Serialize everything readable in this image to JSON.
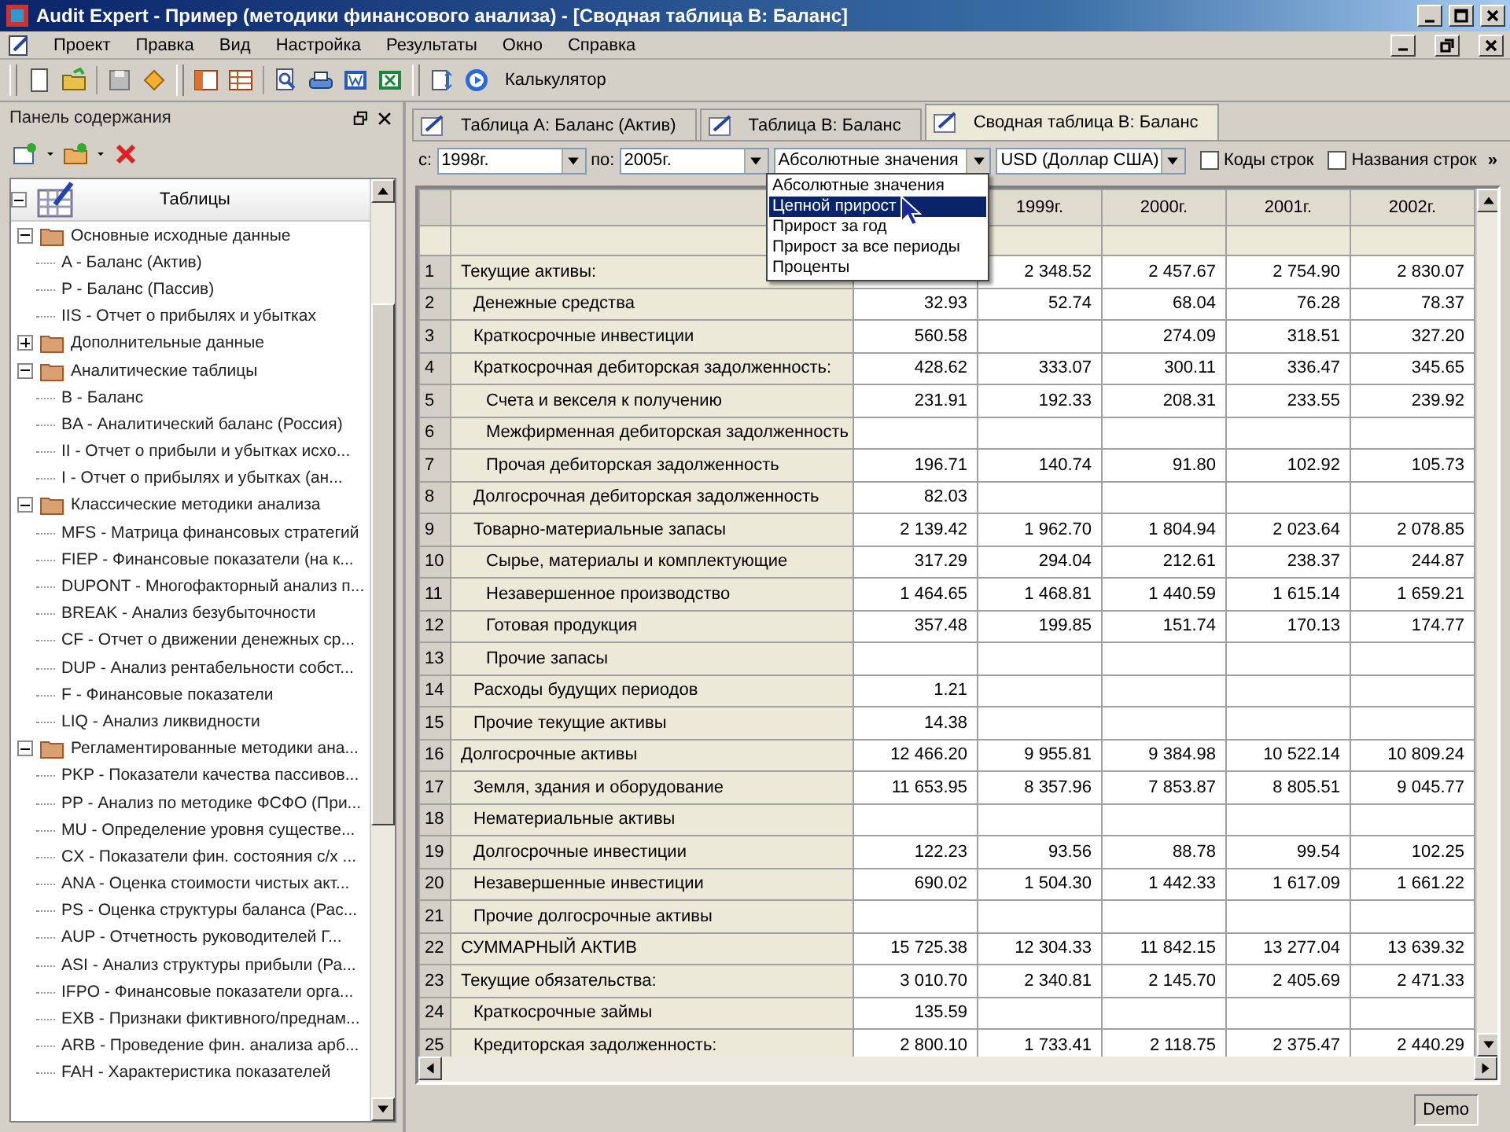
{
  "window": {
    "title": "Audit Expert - Пример (методики финансового анализа)  - [Сводная таблица В: Баланс]"
  },
  "menu": [
    "Проект",
    "Правка",
    "Вид",
    "Настройка",
    "Результаты",
    "Окно",
    "Справка"
  ],
  "toolbar": {
    "calculator": "Калькулятор"
  },
  "contents_panel": {
    "title": "Панель содержания",
    "tree": {
      "label": "Таблицы",
      "expanded": true,
      "children": [
        {
          "label": "Основные исходные данные",
          "expanded": true,
          "children": [
            {
              "label": "A - Баланс (Актив)"
            },
            {
              "label": "P - Баланс (Пассив)"
            },
            {
              "label": "IIS - Отчет о прибылях и убытках"
            }
          ]
        },
        {
          "label": "Дополнительные данные",
          "expanded": false
        },
        {
          "label": "Аналитические таблицы",
          "expanded": true,
          "children": [
            {
              "label": "B - Баланс"
            },
            {
              "label": "BA - Аналитический баланс (Россия)"
            },
            {
              "label": "II - Отчет о прибыли и убытках исхо..."
            },
            {
              "label": "I - Отчет о прибылях и убытках (ан..."
            }
          ]
        },
        {
          "label": "Классические методики анализа",
          "expanded": true,
          "children": [
            {
              "label": "MFS - Матрица финансовых стратегий"
            },
            {
              "label": "FIEP - Финансовые показатели (на к..."
            },
            {
              "label": "DUPONT - Многофакторный анализ п..."
            },
            {
              "label": "BREAK - Анализ безубыточности"
            },
            {
              "label": "CF - Отчет о движении денежных ср..."
            },
            {
              "label": "DUP - Анализ рентабельности собст..."
            },
            {
              "label": "F - Финансовые показатели"
            },
            {
              "label": "LIQ - Анализ ликвидности"
            }
          ]
        },
        {
          "label": "Регламентированные методики ана...",
          "expanded": true,
          "children": [
            {
              "label": "PKP - Показатели качества пассивов..."
            },
            {
              "label": "PP - Анализ по методике ФСФО (При..."
            },
            {
              "label": "MU - Определение уровня существе..."
            },
            {
              "label": "CX - Показатели фин. состояния с/х ..."
            },
            {
              "label": "ANA - Оценка стоимости чистых акт..."
            },
            {
              "label": "PS - Оценка структуры баланса (Рас..."
            },
            {
              "label": "AUP - Отчетность руководителей Г..."
            },
            {
              "label": "ASI - Анализ структуры прибыли (Ра..."
            },
            {
              "label": "IFPO - Финансовые показатели орга..."
            },
            {
              "label": "EXB - Признаки фиктивного/преднам..."
            },
            {
              "label": "ARB - Проведение фин. анализа арб..."
            },
            {
              "label": "FAH - Характеристика показателей"
            }
          ]
        }
      ]
    }
  },
  "tabs": [
    {
      "label": "Таблица А: Баланс (Актив)",
      "selected": false
    },
    {
      "label": "Таблица В: Баланс",
      "selected": false
    },
    {
      "label": "Сводная таблица В: Баланс",
      "selected": true
    }
  ],
  "filters": {
    "from_label": "с:",
    "from": "1998г.",
    "to_label": "по:",
    "to": "2005г.",
    "mode": "Абсолютные значения",
    "currency": "USD (Доллар США)",
    "checkboxes": [
      {
        "label": "Коды строк",
        "checked": false
      },
      {
        "label": "Названия строк",
        "checked": false
      }
    ],
    "more": "»"
  },
  "mode_dropdown": [
    {
      "label": "Абсолютные значения",
      "selected": false
    },
    {
      "label": "Цепной прирост",
      "selected": true
    },
    {
      "label": "Прирост за год",
      "selected": false
    },
    {
      "label": "Прирост за все периоды",
      "selected": false
    },
    {
      "label": "Проценты",
      "selected": false
    }
  ],
  "table": {
    "columns": [
      "",
      "1999г.",
      "2000г.",
      "2001г.",
      "2002г."
    ],
    "rows": [
      {
        "num": "1",
        "label": "Текущие активы:",
        "cells": [
          {
            "blank": true
          },
          {
            "value": "2 348.52"
          },
          {
            "value": "2 457.67"
          },
          {
            "value": "2 754.90"
          },
          {
            "value": "2 830.07"
          }
        ],
        "children": [
          {
            "num": "2",
            "label": "Денежные средства",
            "cells": [
              {
                "value": "32.93"
              },
              {
                "value": "52.74"
              },
              {
                "value": "68.04"
              },
              {
                "value": "76.28"
              },
              {
                "value": "78.37"
              }
            ]
          },
          {
            "num": "3",
            "label": "Краткосрочные инвестиции",
            "cells": [
              {
                "value": "560.58"
              },
              {
                "blank": true
              },
              {
                "value": "274.09"
              },
              {
                "value": "318.51"
              },
              {
                "value": "327.20"
              }
            ]
          },
          {
            "num": "4",
            "label": "Краткосрочная дебиторская задолженность:",
            "cells": [
              {
                "value": "428.62"
              },
              {
                "value": "333.07"
              },
              {
                "value": "300.11"
              },
              {
                "value": "336.47"
              },
              {
                "value": "345.65"
              }
            ],
            "children": [
              {
                "num": "5",
                "label": "Счета и векселя к получению",
                "cells": [
                  {
                    "value": "231.91"
                  },
                  {
                    "value": "192.33"
                  },
                  {
                    "value": "208.31"
                  },
                  {
                    "value": "233.55"
                  },
                  {
                    "value": "239.92"
                  }
                ]
              },
              {
                "num": "6",
                "label": "Межфирменная дебиторская задолженность"
              },
              {
                "num": "7",
                "label": "Прочая дебиторская задолженность",
                "cells": [
                  {
                    "value": "196.71"
                  },
                  {
                    "value": "140.74"
                  },
                  {
                    "value": "91.80"
                  },
                  {
                    "value": "102.92"
                  },
                  {
                    "value": "105.73"
                  }
                ]
              }
            ]
          },
          {
            "num": "8",
            "label": "Долгосрочная дебиторская задолженность",
            "cells": [
              {
                "value": "82.03"
              }
            ]
          },
          {
            "num": "9",
            "label": "Товарно-материальные запасы",
            "cells": [
              {
                "value": "2 139.42"
              },
              {
                "value": "1 962.70"
              },
              {
                "value": "1 804.94"
              },
              {
                "value": "2 023.64"
              },
              {
                "value": "2 078.85"
              }
            ],
            "children": [
              {
                "num": "10",
                "label": "Сырье, материалы и комплектующие",
                "cells": [
                  {
                    "value": "317.29"
                  },
                  {
                    "value": "294.04"
                  },
                  {
                    "value": "212.61"
                  },
                  {
                    "value": "238.37"
                  },
                  {
                    "value": "244.87"
                  }
                ]
              },
              {
                "num": "11",
                "label": "Незавершенное производство",
                "cells": [
                  {
                    "value": "1 464.65"
                  },
                  {
                    "value": "1 468.81"
                  },
                  {
                    "value": "1 440.59"
                  },
                  {
                    "value": "1 615.14"
                  },
                  {
                    "value": "1 659.21"
                  }
                ]
              },
              {
                "num": "12",
                "label": "Готовая продукция",
                "cells": [
                  {
                    "value": "357.48"
                  },
                  {
                    "value": "199.85"
                  },
                  {
                    "value": "151.74"
                  },
                  {
                    "value": "170.13"
                  },
                  {
                    "value": "174.77"
                  }
                ]
              },
              {
                "num": "13",
                "label": "Прочие запасы"
              }
            ]
          },
          {
            "num": "14",
            "label": "Расходы будущих периодов",
            "cells": [
              {
                "value": "1.21"
              }
            ]
          },
          {
            "num": "15",
            "label": "Прочие текущие активы",
            "cells": [
              {
                "value": "14.38"
              }
            ]
          }
        ]
      },
      {
        "num": "16",
        "label": "Долгосрочные активы",
        "cells": [
          {
            "value": "12 466.20"
          },
          {
            "value": "9 955.81"
          },
          {
            "value": "9 384.98"
          },
          {
            "value": "10 522.14"
          },
          {
            "value": "10 809.24"
          }
        ],
        "children": [
          {
            "num": "17",
            "label": "Земля, здания и оборудование",
            "cells": [
              {
                "value": "11 653.95"
              },
              {
                "value": "8 357.96"
              },
              {
                "value": "7 853.87"
              },
              {
                "value": "8 805.51"
              },
              {
                "value": "9 045.77"
              }
            ]
          },
          {
            "num": "18",
            "label": "Нематериальные активы"
          },
          {
            "num": "19",
            "label": "Долгосрочные инвестиции",
            "cells": [
              {
                "value": "122.23"
              },
              {
                "value": "93.56"
              },
              {
                "value": "88.78"
              },
              {
                "value": "99.54"
              },
              {
                "value": "102.25"
              }
            ]
          },
          {
            "num": "20",
            "label": "Незавершенные инвестиции",
            "cells": [
              {
                "value": "690.02"
              },
              {
                "value": "1 504.30"
              },
              {
                "value": "1 442.33"
              },
              {
                "value": "1 617.09"
              },
              {
                "value": "1 661.22"
              }
            ]
          },
          {
            "num": "21",
            "label": "Прочие долгосрочные активы"
          }
        ]
      },
      {
        "num": "22",
        "label": "СУММАРНЫЙ АКТИВ",
        "cells": [
          {
            "value": "15 725.38"
          },
          {
            "value": "12 304.33"
          },
          {
            "value": "11 842.15"
          },
          {
            "value": "13 277.04"
          },
          {
            "value": "13 639.32"
          }
        ]
      },
      {
        "num": "23",
        "label": "Текущие обязательства:",
        "cells": [
          {
            "value": "3 010.70"
          },
          {
            "value": "2 340.81"
          },
          {
            "value": "2 145.70"
          },
          {
            "value": "2 405.69"
          },
          {
            "value": "2 471.33"
          }
        ],
        "children": [
          {
            "num": "24",
            "label": "Краткосрочные займы",
            "cells": [
              {
                "value": "135.59"
              }
            ]
          },
          {
            "num": "25",
            "label": "Кредиторская задолженность:",
            "cells": [
              {
                "value": "2 800.10"
              },
              {
                "value": "1 733.41"
              },
              {
                "value": "2 118.75"
              },
              {
                "value": "2 375.47"
              },
              {
                "value": "2 440.29"
              }
            ]
          }
        ]
      }
    ]
  },
  "status_bar": {
    "badge": "Demo"
  }
}
